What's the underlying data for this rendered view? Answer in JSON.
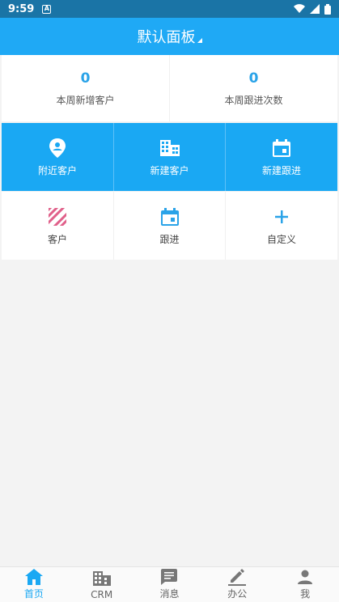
{
  "status_bar": {
    "time": "9:59",
    "notification_glyph": "A"
  },
  "header": {
    "title": "默认面板"
  },
  "stats": [
    {
      "value": "0",
      "label": "本周新增客户"
    },
    {
      "value": "0",
      "label": "本周跟进次数"
    }
  ],
  "actions_primary": [
    {
      "label": "附近客户",
      "icon": "location-pin-icon"
    },
    {
      "label": "新建客户",
      "icon": "building-icon"
    },
    {
      "label": "新建跟进",
      "icon": "calendar-icon"
    }
  ],
  "actions_secondary": [
    {
      "label": "客户",
      "icon": "striped-square-icon"
    },
    {
      "label": "跟进",
      "icon": "calendar-icon"
    },
    {
      "label": "自定义",
      "icon": "plus-icon"
    }
  ],
  "tabs": [
    {
      "label": "首页",
      "icon": "home-icon",
      "active": true
    },
    {
      "label": "CRM",
      "icon": "building-icon",
      "active": false
    },
    {
      "label": "消息",
      "icon": "message-icon",
      "active": false
    },
    {
      "label": "办公",
      "icon": "pencil-icon",
      "active": false
    },
    {
      "label": "我",
      "icon": "person-icon",
      "active": false
    }
  ],
  "colors": {
    "status_bar": "#1a74a6",
    "primary": "#1fa9f5",
    "tile_blue": "#1aa8f3",
    "number": "#2aa3e8",
    "customer_icon": "#e0608a"
  }
}
